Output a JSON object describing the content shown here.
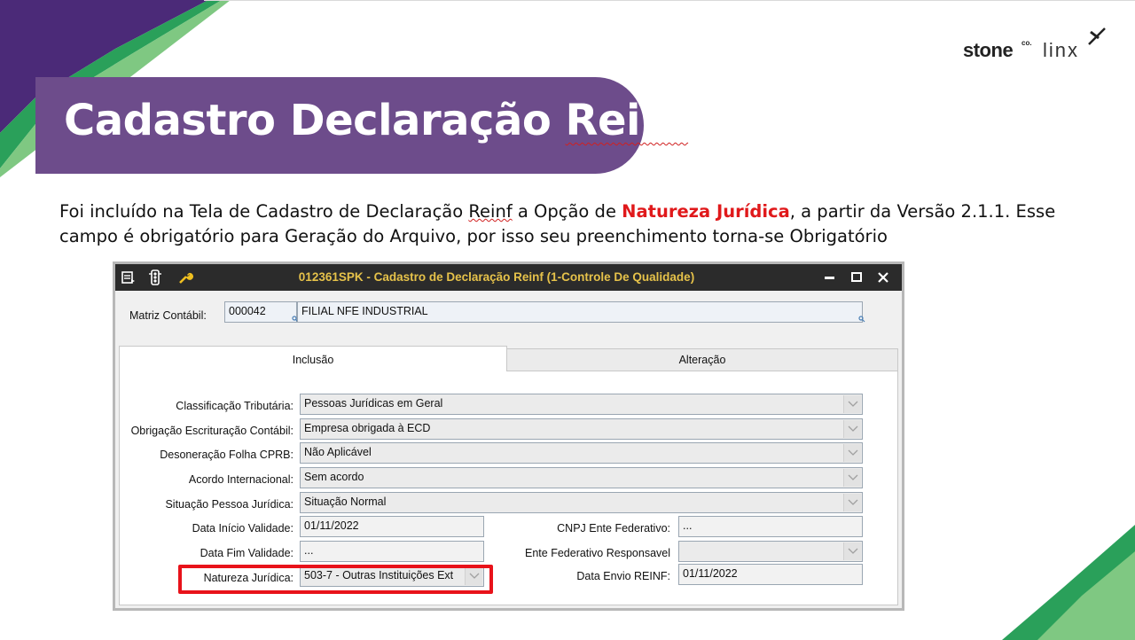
{
  "slide": {
    "title": "Cadastro Declaração Reinf",
    "title_prefix": "Cadastro Declaração ",
    "title_squiggle": "Reinf",
    "body_part1": "Foi incluído na Tela de Cadastro de Declaração ",
    "body_reinf": "Reinf",
    "body_part2": " a Opção de ",
    "body_highlight": "Natureza Jurídica",
    "body_part3": ", a partir da Versão 2.1.1. Esse campo é obrigatório para Geração do Arquivo, por isso seu preenchimento torna-se Obrigatório",
    "logo_stone": "stone",
    "logo_co": "co.",
    "logo_linx": "linx"
  },
  "window": {
    "title": "012361SPK - Cadastro de Declaração Reinf (1-Controle De Qualidade)",
    "icons": [
      "menu-icon",
      "traffic-light-icon",
      "wrench-icon"
    ],
    "controls": [
      "minimize-icon",
      "maximize-icon",
      "close-icon"
    ]
  },
  "matriz": {
    "label": "Matriz Contábil:",
    "code": "000042",
    "name": "FILIAL NFE INDUSTRIAL"
  },
  "tabs": [
    {
      "label": "Inclusão",
      "active": true
    },
    {
      "label": "Alteração",
      "active": false
    }
  ],
  "form": {
    "classificacao": {
      "label": "Classificação Tributária:",
      "value": "Pessoas Jurídicas em Geral"
    },
    "obrigacao": {
      "label": "Obrigação Escrituração Contábil:",
      "value": "Empresa obrigada à ECD"
    },
    "desoneracao": {
      "label": "Desoneração Folha CPRB:",
      "value": "Não Aplicável"
    },
    "acordo": {
      "label": "Acordo Internacional:",
      "value": "Sem acordo"
    },
    "situacao": {
      "label": "Situação Pessoa Jurídica:",
      "value": "Situação Normal"
    },
    "data_inicio": {
      "label": "Data Início Validade:",
      "value": "01/11/2022"
    },
    "data_fim": {
      "label": "Data Fim Validade:",
      "value": "..."
    },
    "natureza": {
      "label": "Natureza Jurídica:",
      "value": "503-7 - Outras Instituições Ext"
    },
    "cnpj_ente": {
      "label": "CNPJ Ente Federativo:",
      "value": "..."
    },
    "ente_resp": {
      "label": "Ente Federativo Responsavel",
      "value": ""
    },
    "data_envio": {
      "label": "Data Envio REINF:",
      "value": "01/11/2022"
    }
  },
  "colors": {
    "title_band": "#6d4c8b",
    "highlight": "#e0191b",
    "titlebar": "#2b2b2b",
    "titlebar_text": "#e6c24a"
  }
}
